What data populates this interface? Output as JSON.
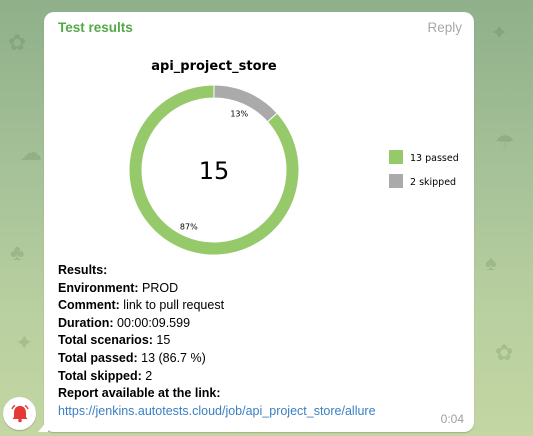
{
  "message": {
    "sender": "Test results",
    "reply_label": "Reply",
    "time": "0:04"
  },
  "chart_data": {
    "type": "pie",
    "title": "api_project_store",
    "center_label": "15",
    "slices": [
      {
        "name": "13 passed",
        "value": 13,
        "pct_label": "87%",
        "color": "#96c96a"
      },
      {
        "name": "2 skipped",
        "value": 2,
        "pct_label": "13%",
        "color": "#aaaaaa"
      }
    ],
    "legend": {
      "placement": "right",
      "entries": [
        "13 passed",
        "2 skipped"
      ]
    },
    "style": "donut"
  },
  "results": {
    "heading": "Results:",
    "environment_label": "Environment:",
    "environment_value": " PROD",
    "comment_label": "Comment:",
    "comment_value": " link to pull request",
    "duration_label": "Duration:",
    "duration_value": " 00:00:09.599",
    "total_scenarios_label": "Total scenarios:",
    "total_scenarios_value": " 15",
    "total_passed_label": "Total passed:",
    "total_passed_value": " 13 (86.7 %)",
    "total_skipped_label": "Total skipped:",
    "total_skipped_value": " 2",
    "report_label": "Report available at the link:",
    "report_url": "https://jenkins.autotests.cloud/job/api_project_store/allure"
  }
}
